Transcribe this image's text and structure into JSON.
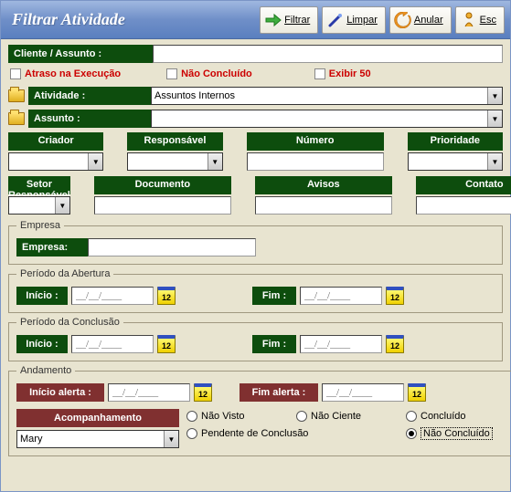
{
  "title": "Filtrar Atividade",
  "toolbar": {
    "filtrar": "Filtrar",
    "limpar": "Limpar",
    "anular": "Anular",
    "esc": "Esc"
  },
  "cliente_assunto_label": "Cliente / Assunto :",
  "cliente_assunto_value": "",
  "checks": {
    "atraso": "Atraso na Execução",
    "nao_concluido": "Não Concluído",
    "exibir50": "Exibir 50"
  },
  "atividade_label": "Atividade :",
  "atividade_value": "Assuntos Internos",
  "assunto_label": "Assunto :",
  "assunto_value": "",
  "cols1": {
    "criador": "Criador",
    "responsavel": "Responsável",
    "numero": "Número",
    "prioridade": "Prioridade"
  },
  "cols2": {
    "setor": "Setor Responsável",
    "documento": "Documento",
    "avisos": "Avisos",
    "contato": "Contato"
  },
  "empresa_legend": "Empresa",
  "empresa_label": "Empresa:",
  "empresa_value": "",
  "periodo_abertura_legend": "Período da Abertura",
  "periodo_conclusao_legend": "Período da Conclusão",
  "andamento_legend": "Andamento",
  "inicio_label": "Início :",
  "fim_label": "Fim :",
  "inicio_alerta_label": "Início alerta :",
  "fim_alerta_label": "Fim alerta :",
  "date_placeholder": "__/__/____",
  "cal_text": "12",
  "acompanhamento_label": "Acompanhamento",
  "acompanhamento_value": "Mary",
  "radios": {
    "nao_visto": "Não Visto",
    "nao_ciente": "Não Ciente",
    "concluido": "Concluído",
    "pendente": "Pendente de Conclusão",
    "nao_concluido2": "Não Concluído"
  }
}
